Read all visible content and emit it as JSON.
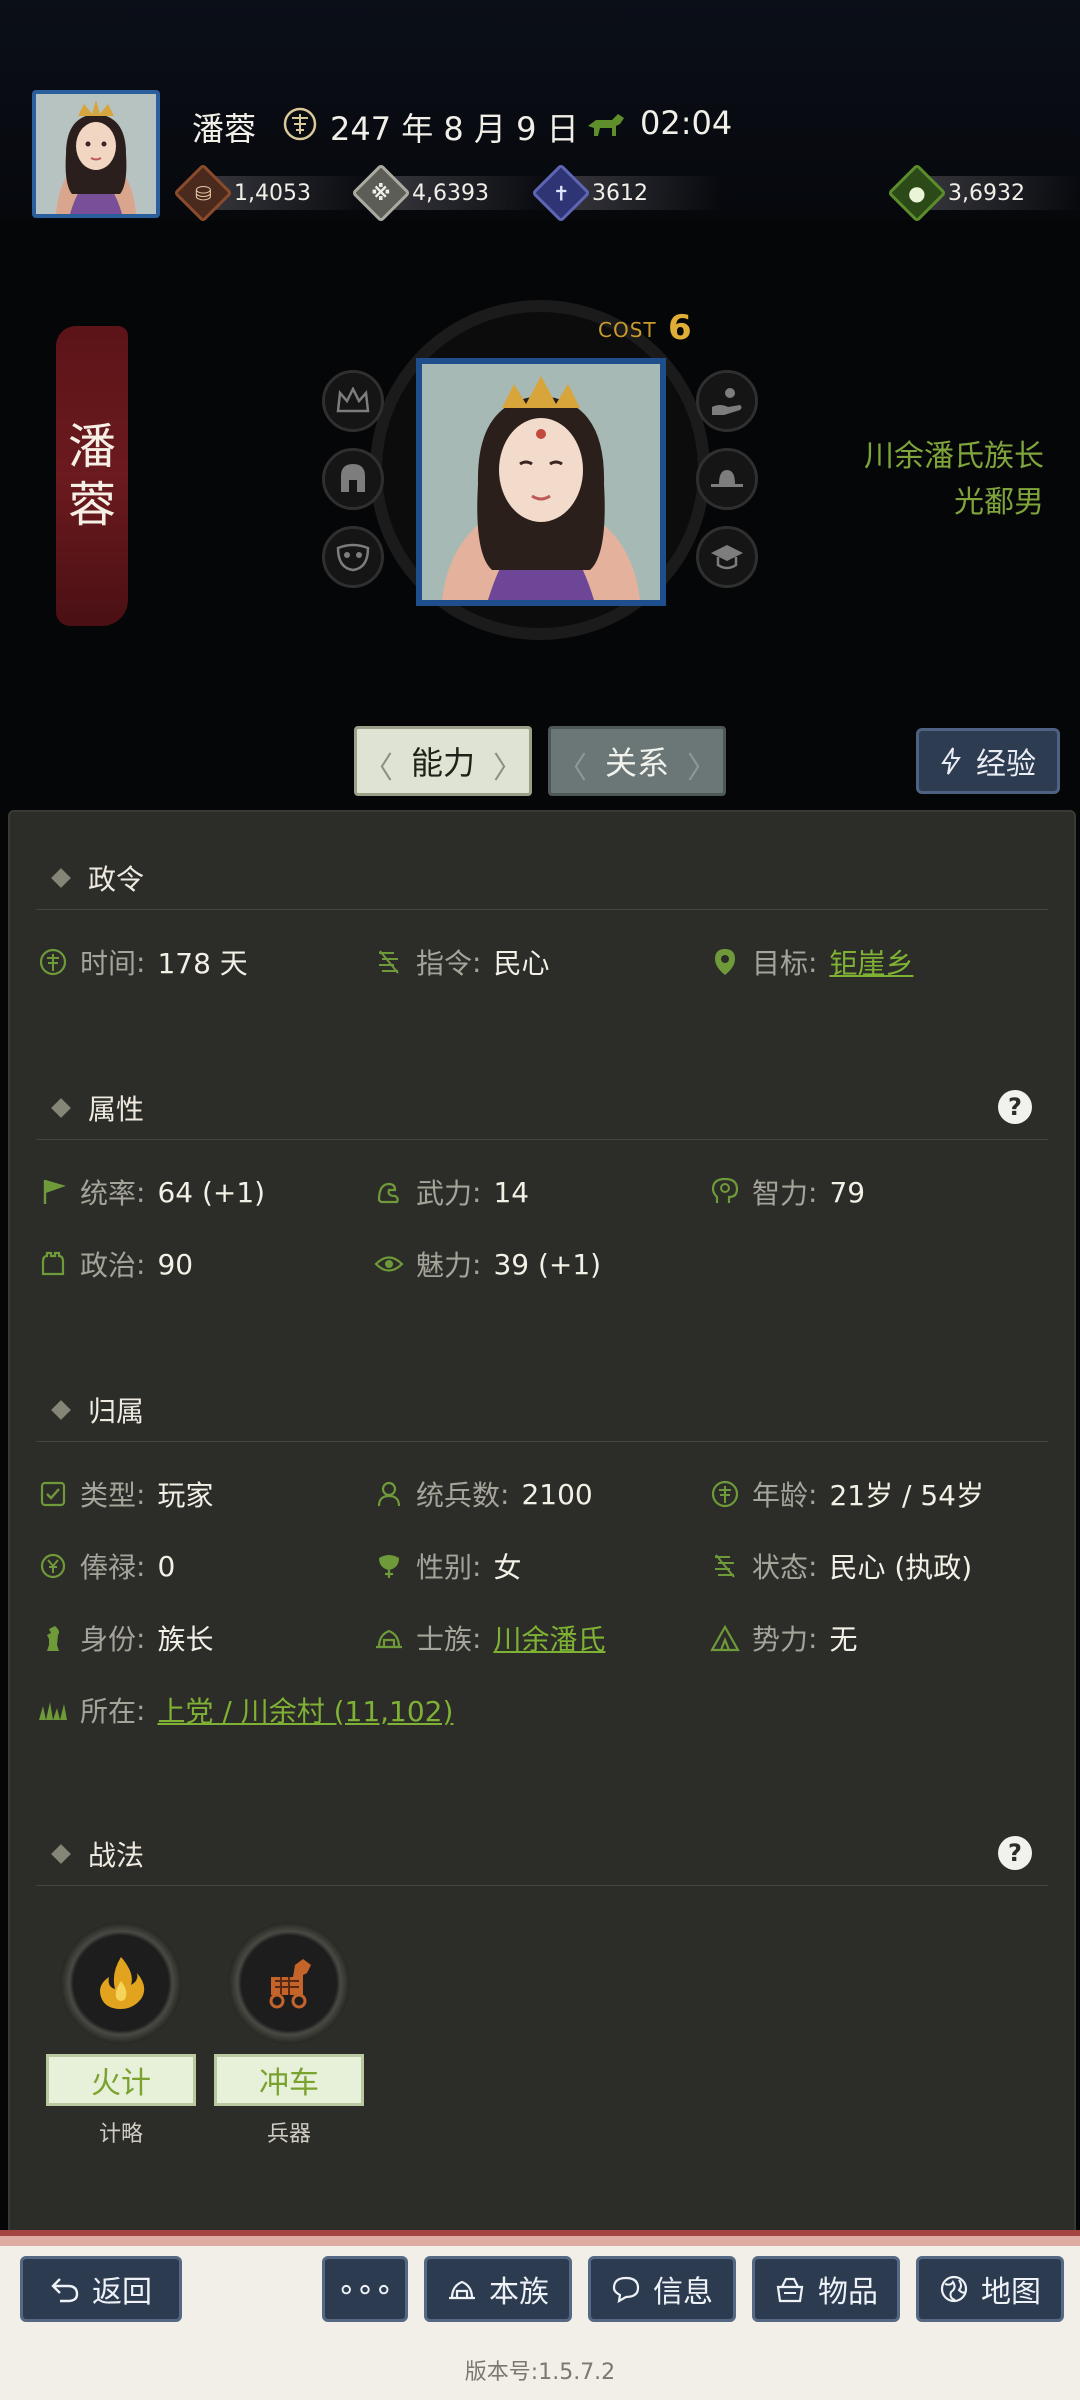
{
  "header": {
    "name": "潘蓉",
    "date": "247 年 8 月 9 日",
    "time": "02:04",
    "resources": [
      {
        "icon": "coin-icon",
        "value": "1,4053",
        "color": "#8a4a2c"
      },
      {
        "icon": "grain-icon",
        "value": "4,6393",
        "color": "#a9aaa0"
      },
      {
        "icon": "soldier-icon",
        "value": "3612",
        "color": "#5e66b4"
      },
      {
        "icon": "money-bag-icon",
        "value": "3,6932",
        "color": "#5a8c2c"
      }
    ]
  },
  "hero": {
    "banner_chars": [
      "潘",
      "蓉"
    ],
    "cost_label": "COST",
    "cost_value": "6",
    "titles": [
      "川余潘氏族长",
      "光鄱男"
    ]
  },
  "tabs": {
    "ability": "能力",
    "relation": "关系",
    "experience": "经验"
  },
  "sections": {
    "decree": {
      "title": "政令",
      "time_label": "时间",
      "time_value": "178 天",
      "order_label": "指令",
      "order_value": "民心",
      "target_label": "目标",
      "target_value": "钜崖乡"
    },
    "attributes": {
      "title": "属性",
      "help": "?",
      "command_label": "统率",
      "command_value": "64 (+1)",
      "force_label": "武力",
      "force_value": "14",
      "intellect_label": "智力",
      "intellect_value": "79",
      "politics_label": "政治",
      "politics_value": "90",
      "charm_label": "魅力",
      "charm_value": "39 (+1)"
    },
    "affiliation": {
      "title": "归属",
      "type_label": "类型",
      "type_value": "玩家",
      "troops_label": "统兵数",
      "troops_value": "2100",
      "age_label": "年龄",
      "age_value": "21岁 / 54岁",
      "salary_label": "俸禄",
      "salary_value": "0",
      "gender_label": "性别",
      "gender_value": "女",
      "status_label": "状态",
      "status_value": "民心 (执政)",
      "identity_label": "身份",
      "identity_value": "族长",
      "clan_label": "士族",
      "clan_value": "川余潘氏",
      "faction_label": "势力",
      "faction_value": "无",
      "location_label": "所在",
      "location_value": "上党 / 川余村 (11,102)"
    },
    "tactics": {
      "title": "战法",
      "help": "?",
      "items": [
        {
          "name": "火计",
          "kind": "计略",
          "icon": "fire-icon"
        },
        {
          "name": "冲车",
          "kind": "兵器",
          "icon": "siege-horse-icon"
        }
      ]
    }
  },
  "bottom_nav": {
    "back": "返回",
    "more": "∘∘∘",
    "clan": "本族",
    "info": "信息",
    "items": "物品",
    "map": "地图"
  },
  "version": "版本号:1.5.7.2"
}
